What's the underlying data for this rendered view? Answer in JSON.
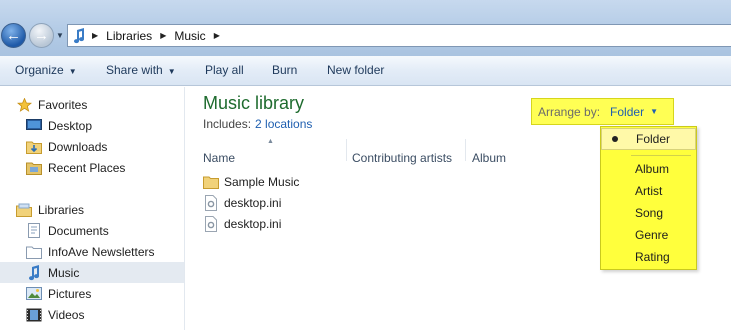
{
  "address": {
    "crumbs": [
      "Libraries",
      "Music"
    ]
  },
  "toolbar": {
    "organize": "Organize",
    "share_with": "Share with",
    "play_all": "Play all",
    "burn": "Burn",
    "new_folder": "New folder"
  },
  "nav": {
    "favorites": "Favorites",
    "desktop": "Desktop",
    "downloads": "Downloads",
    "recent_places": "Recent Places",
    "libraries": "Libraries",
    "documents": "Documents",
    "infoave": "InfoAve Newsletters",
    "music": "Music",
    "pictures": "Pictures",
    "videos": "Videos"
  },
  "content": {
    "title": "Music library",
    "includes_label": "Includes:",
    "includes_link": "2 locations",
    "columns": [
      "Name",
      "Contributing artists",
      "Album"
    ],
    "files": [
      "Sample Music",
      "desktop.ini",
      "desktop.ini"
    ]
  },
  "arrange": {
    "label": "Arrange by:",
    "value": "Folder",
    "options": [
      "Folder",
      "Album",
      "Artist",
      "Song",
      "Genre",
      "Rating"
    ],
    "selected": "Folder"
  },
  "colors": {
    "title_green": "#1e6b2e",
    "link_blue": "#1f5fb0",
    "highlight_yellow": "#ffff54"
  }
}
